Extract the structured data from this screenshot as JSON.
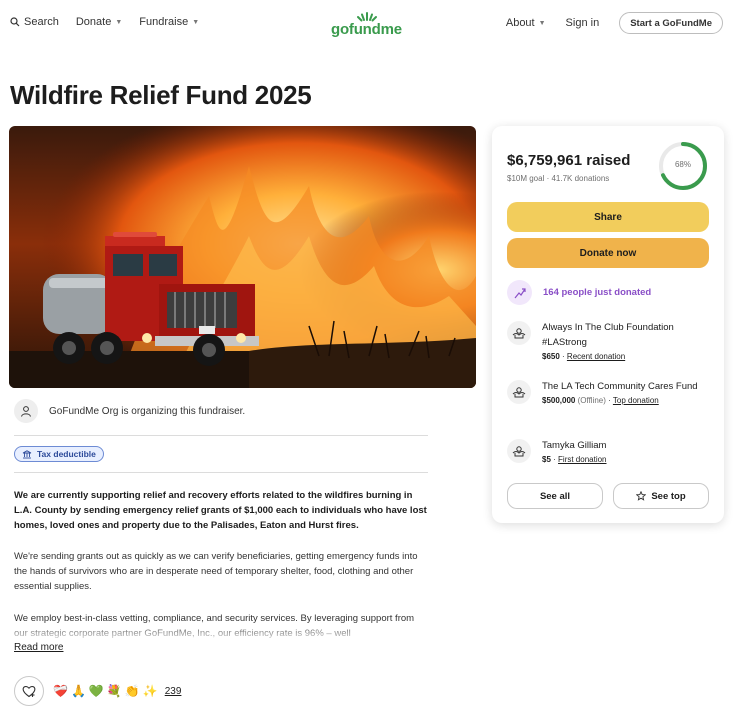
{
  "header": {
    "search_label": "Search",
    "donate_label": "Donate",
    "fundraise_label": "Fundraise",
    "logo_text": "gofundme",
    "about_label": "About",
    "signin_label": "Sign in",
    "start_label": "Start a GoFundMe"
  },
  "page": {
    "title": "Wildfire Relief Fund 2025"
  },
  "organizer": {
    "text": "GoFundMe Org is organizing this fundraiser."
  },
  "badge": {
    "label": "Tax deductible"
  },
  "story": {
    "p1": "We are currently supporting relief and recovery efforts related to the wildfires burning in L.A. County by sending emergency relief grants of $1,000 each to individuals who have lost homes, loved ones and property due to the Palisades, Eaton and Hurst fires.",
    "p2": "We're sending grants out as quickly as we can verify beneficiaries, getting emergency funds into the hands of survivors who are in desperate need of temporary shelter, food, clothing and other essential supplies.",
    "p3": "We employ best-in-class vetting, compliance, and security services. By leveraging support from our strategic corporate partner GoFundMe, Inc., our efficiency rate is 96% – well",
    "read_more": "Read more"
  },
  "reactions": {
    "emojis": [
      "❤️‍🩹",
      "🙏",
      "💚",
      "💐",
      "👏",
      "✨"
    ],
    "count": "239"
  },
  "card": {
    "raised": "$6,759,961 raised",
    "goal": "$10M goal · 41.7K donations",
    "progress_percent": 68,
    "progress_label": "68%",
    "share_label": "Share",
    "donate_label": "Donate now",
    "pulse_text": "164 people just donated",
    "donors": [
      {
        "name": "Always In The Club Foundation #LAStrong",
        "amount": "$650",
        "note": "",
        "tag": "Recent donation"
      },
      {
        "name": "The LA Tech Community Cares Fund",
        "amount": "$500,000",
        "note": "(Offline)",
        "tag": "Top donation"
      },
      {
        "name": "Tamyka Gilliam",
        "amount": "$5",
        "note": "",
        "tag": "First donation"
      }
    ],
    "see_all_label": "See all",
    "see_top_label": "See top"
  },
  "colors": {
    "brand_green": "#3a9b4d",
    "share_yellow": "#f2cd5c",
    "donate_orange": "#f0b34b",
    "pulse_purple": "#8a4fc7",
    "badge_blue": "#2c4a9a"
  }
}
